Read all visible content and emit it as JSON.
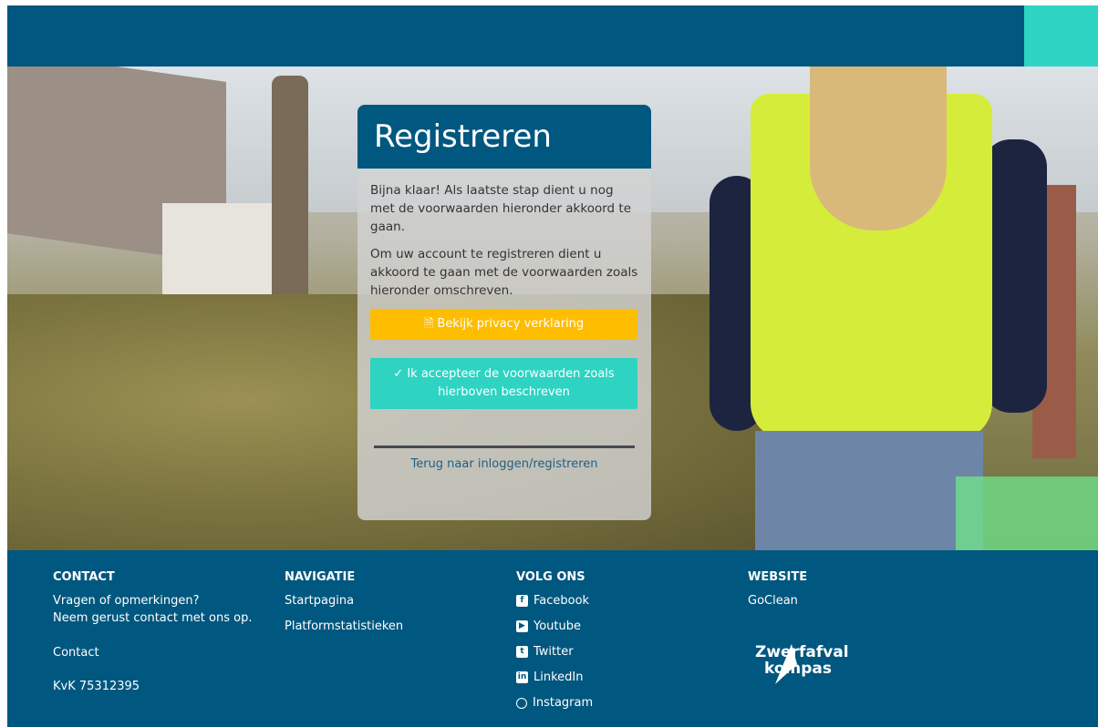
{
  "card": {
    "title": "Registreren",
    "paragraph1": "Bijna klaar! Als laatste stap dient u nog met de voorwaarden hieronder akkoord te gaan.",
    "paragraph2": "Om uw account te registreren dient u akkoord te gaan met de voorwaarden zoals hieronder omschreven.",
    "privacy_button": "Bekijk privacy verklaring",
    "accept_button": "Ik accepteer de voorwaarden zoals hierboven beschreven",
    "back_link": "Terug naar inloggen/registreren"
  },
  "footer": {
    "contact": {
      "heading": "CONTACT",
      "line1": "Vragen of opmerkingen?",
      "line2": "Neem gerust contact met ons op.",
      "contact_link": "Contact",
      "kvk": "KvK 75312395"
    },
    "navigatie": {
      "heading": "NAVIGATIE",
      "items": [
        "Startpagina",
        "Platformstatistieken"
      ]
    },
    "volg_ons": {
      "heading": "VOLG ONS",
      "items": [
        "Facebook",
        "Youtube",
        "Twitter",
        "LinkedIn",
        "Instagram"
      ]
    },
    "website": {
      "heading": "WEBSITE",
      "link": "GoClean",
      "logo_line1": "Zwerfafval",
      "logo_line2": "kompas"
    }
  },
  "colors": {
    "primary": "#00577f",
    "accent": "#2ed3c2",
    "warning": "#ffbd00"
  }
}
